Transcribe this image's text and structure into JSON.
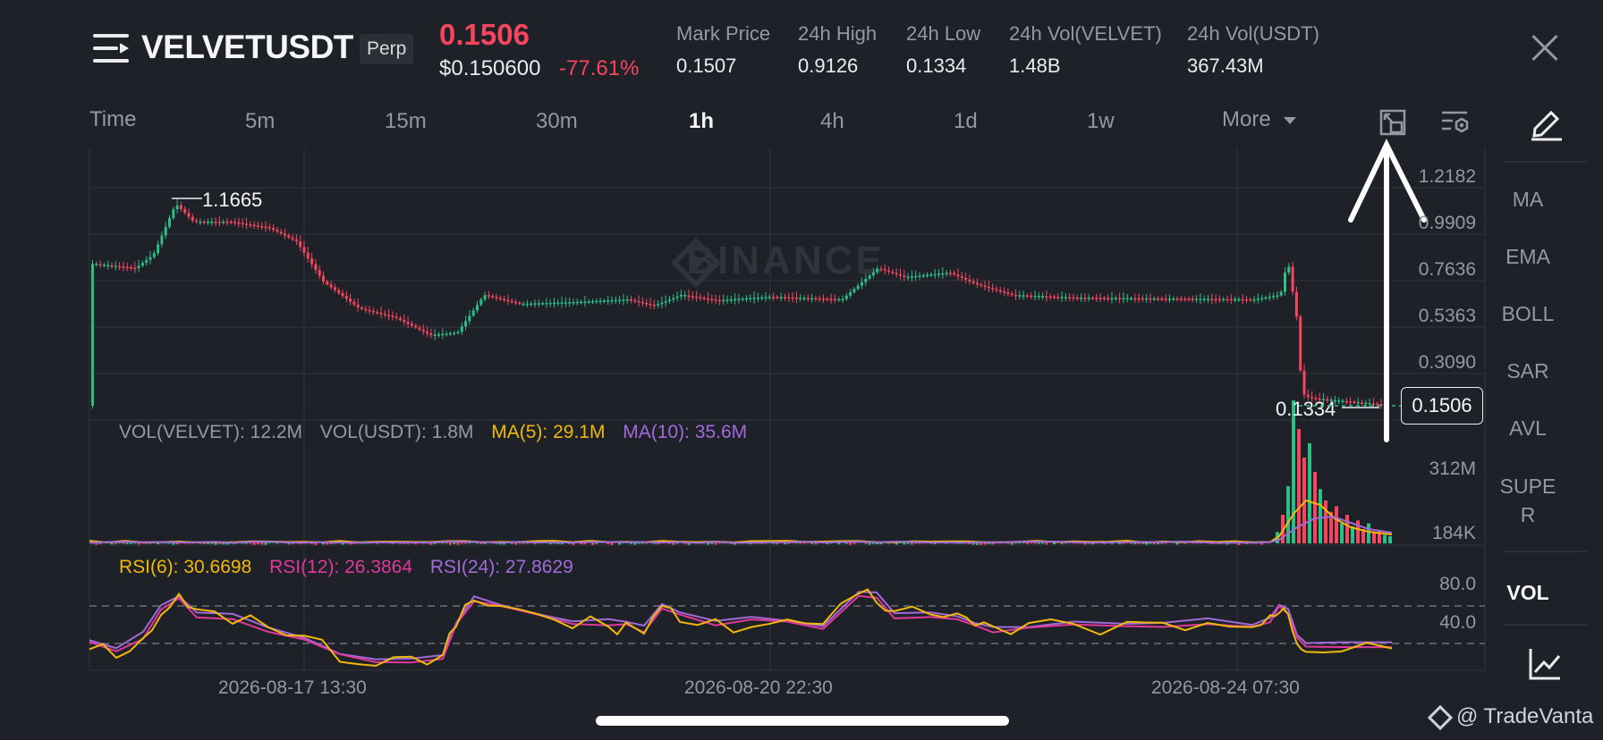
{
  "header": {
    "symbol": "VELVETUSDT",
    "contract_badge": "Perp",
    "last_price": "0.1506",
    "usd_price": "$0.150600",
    "change_pct": "-77.61%",
    "stats": [
      {
        "label": "Mark Price",
        "value": "0.1507"
      },
      {
        "label": "24h High",
        "value": "0.9126"
      },
      {
        "label": "24h Low",
        "value": "0.1334"
      },
      {
        "label": "24h Vol(VELVET)",
        "value": "1.48B"
      },
      {
        "label": "24h Vol(USDT)",
        "value": "367.43M"
      }
    ]
  },
  "timeframes": {
    "time_label": "Time",
    "items": [
      "5m",
      "15m",
      "30m",
      "1h",
      "4h",
      "1d",
      "1w"
    ],
    "active": "1h",
    "more_label": "More"
  },
  "sidebar": {
    "items": [
      "MA",
      "EMA",
      "BOLL",
      "SAR",
      "AVL",
      "SUPE\nR"
    ],
    "vol_label": "VOL"
  },
  "chart": {
    "watermark": "BINANCE",
    "price_axis": [
      "1.2182",
      "0.9909",
      "0.7636",
      "0.5363",
      "0.3090"
    ],
    "current_price_tag": "0.1506",
    "high_marker": "1.1665",
    "low_marker": "0.1334",
    "volume": {
      "legend": [
        {
          "text": "VOL(VELVET): 12.2M",
          "color": "#9499a1"
        },
        {
          "text": "VOL(USDT): 1.8M",
          "color": "#9499a1"
        },
        {
          "text": "MA(5): 29.1M",
          "color": "#f0b90b"
        },
        {
          "text": "MA(10): 35.6M",
          "color": "#a06ad8"
        }
      ],
      "axis": [
        "312M",
        "184K"
      ]
    },
    "rsi": {
      "legend": [
        {
          "text": "RSI(6): 30.6698",
          "color": "#f0b90b"
        },
        {
          "text": "RSI(12): 26.3864",
          "color": "#e0399b"
        },
        {
          "text": "RSI(24): 27.8629",
          "color": "#a06ad8"
        }
      ],
      "axis": [
        "80.0",
        "40.0"
      ]
    },
    "dates": [
      "2026-08-17 13:30",
      "2026-08-20 22:30",
      "2026-08-24 07:30"
    ]
  },
  "watermark_handle": "@ TradeVanta",
  "colors": {
    "up": "#2ebd85",
    "down": "#f6465d",
    "bg": "#1e2128",
    "grid": "#2b2f36"
  }
}
